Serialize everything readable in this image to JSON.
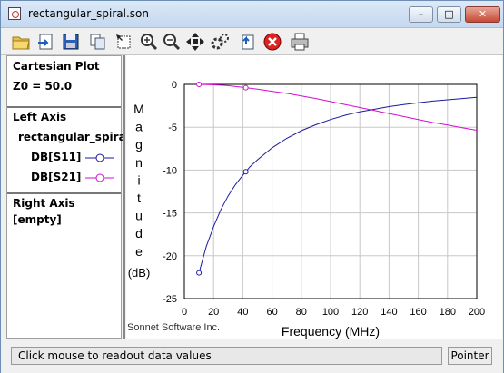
{
  "window": {
    "title": "rectangular_spiral.son",
    "minimize": "–",
    "maximize": "□",
    "close": "✕"
  },
  "toolbar": {
    "icons": [
      "open-folder-icon",
      "import-icon",
      "save-icon",
      "copy-icon",
      "select-icon",
      "zoom-in-icon",
      "zoom-out-icon",
      "pan-icon",
      "settings-icon",
      "refresh-icon",
      "stop-icon",
      "print-icon"
    ]
  },
  "left_panel": {
    "plot_type": "Cartesian Plot",
    "z0": "Z0 = 50.0",
    "left_axis_heading": "Left Axis",
    "left_axis_file": "rectangular_spira",
    "traces": [
      {
        "label": "DB[S11]",
        "color": "#1a1aa0"
      },
      {
        "label": "DB[S21]",
        "color": "#d010d0"
      }
    ],
    "right_axis_heading": "Right Axis",
    "right_axis_value": "[empty]"
  },
  "chart_data": {
    "type": "line",
    "xlabel": "Frequency (MHz)",
    "ylabel_letters": [
      "M",
      "a",
      "g",
      "n",
      "i",
      "t",
      "u",
      "d",
      "e"
    ],
    "ylabel_unit": "(dB)",
    "xlim": [
      0,
      200
    ],
    "ylim": [
      -25,
      0
    ],
    "xticks": [
      0,
      20,
      40,
      60,
      80,
      100,
      120,
      140,
      160,
      180,
      200
    ],
    "yticks": [
      0,
      -5,
      -10,
      -15,
      -20,
      -25
    ],
    "grid": true,
    "credit": "Sonnet Software Inc.",
    "series": [
      {
        "name": "DB[S11]",
        "color": "#1a1aa0",
        "x": [
          10,
          15,
          20,
          25,
          30,
          35,
          40,
          45,
          50,
          60,
          70,
          80,
          90,
          100,
          110,
          120,
          130,
          140,
          150,
          160,
          170,
          180,
          190,
          200
        ],
        "y": [
          -22,
          -18.9,
          -16.6,
          -14.6,
          -13,
          -11.7,
          -10.6,
          -9.6,
          -8.8,
          -7.4,
          -6.3,
          -5.4,
          -4.7,
          -4.1,
          -3.6,
          -3.2,
          -2.9,
          -2.6,
          -2.35,
          -2.15,
          -1.95,
          -1.8,
          -1.65,
          -1.5
        ],
        "markers_x": [
          10,
          42
        ]
      },
      {
        "name": "DB[S21]",
        "color": "#d010d0",
        "x": [
          10,
          20,
          30,
          40,
          50,
          60,
          70,
          80,
          90,
          100,
          110,
          120,
          130,
          140,
          150,
          160,
          170,
          180,
          190,
          200
        ],
        "y": [
          0,
          -0.05,
          -0.15,
          -0.35,
          -0.55,
          -0.8,
          -1.05,
          -1.35,
          -1.65,
          -2.0,
          -2.35,
          -2.7,
          -3.05,
          -3.4,
          -3.75,
          -4.1,
          -4.45,
          -4.75,
          -5.05,
          -5.35
        ],
        "markers_x": [
          10,
          42
        ]
      }
    ]
  },
  "status": {
    "message": "Click mouse to readout data values",
    "mode_button": "Pointer"
  }
}
